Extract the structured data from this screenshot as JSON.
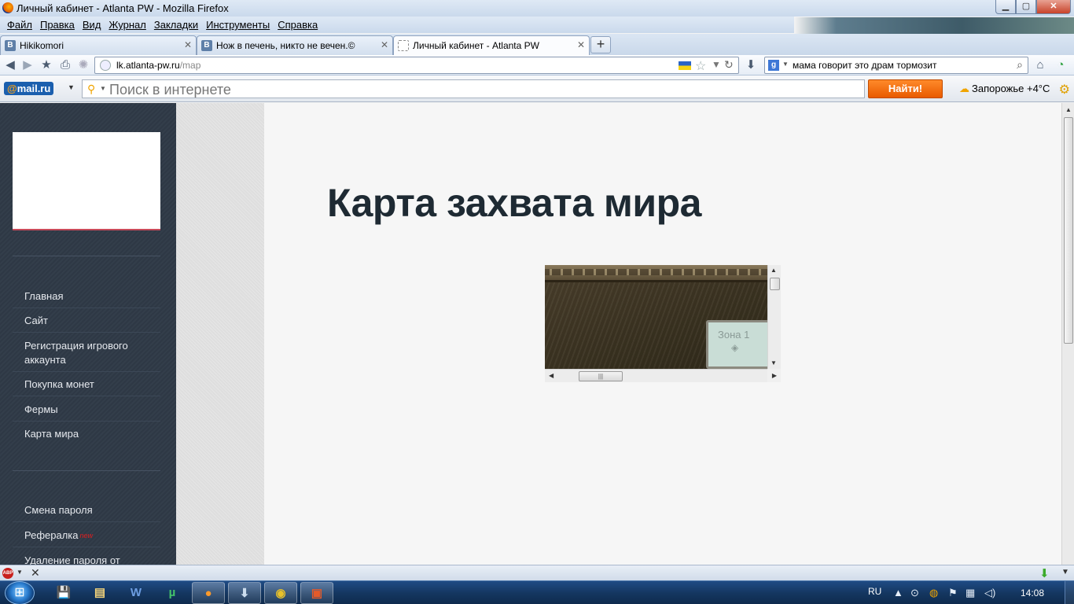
{
  "window": {
    "title": "Личный кабинет - Atlanta PW - Mozilla Firefox"
  },
  "menu": {
    "items": [
      "Файл",
      "Правка",
      "Вид",
      "Журнал",
      "Закладки",
      "Инструменты",
      "Справка"
    ]
  },
  "tabs": [
    {
      "label": "Hikikomori",
      "favicon": "В",
      "active": false
    },
    {
      "label": "Нож в печень, никто не вечен.©",
      "favicon": "В",
      "active": false
    },
    {
      "label": "Личный кабинет - Atlanta PW",
      "favicon": "",
      "active": true
    }
  ],
  "navbar": {
    "url_host": "lk.atlanta-pw.ru",
    "url_path": "/map",
    "search_query": "мама говорит это драм тормозит",
    "search_engine_icon": "g"
  },
  "mailru": {
    "logo_at": "@",
    "logo_text": "mail.ru",
    "search_placeholder": "Поиск в интернете",
    "find_label": "Найти!",
    "weather": "Запорожье +4°C"
  },
  "sidebar": {
    "items_top": [
      {
        "label": "Главная"
      },
      {
        "label": "Сайт"
      },
      {
        "label": "Регистрация игрового аккаунта"
      },
      {
        "label": "Покупка монет"
      },
      {
        "label": "Фермы"
      },
      {
        "label": "Карта мира"
      }
    ],
    "items_bottom": [
      {
        "label": "Смена пароля",
        "badge": ""
      },
      {
        "label": "Рефералка",
        "badge": "new"
      },
      {
        "label": "Удаление пароля от банка",
        "badge": ""
      }
    ]
  },
  "main": {
    "title": "Карта захвата мира",
    "map": {
      "zone_label": "Зона 1"
    }
  },
  "taskbar": {
    "lang": "RU",
    "clock": "14:08"
  },
  "colors": {
    "sidebar_bg": "#2f3a47",
    "find_button": "#ff7a12",
    "title_text": "#1e2a33",
    "new_badge": "#e21e1e"
  }
}
